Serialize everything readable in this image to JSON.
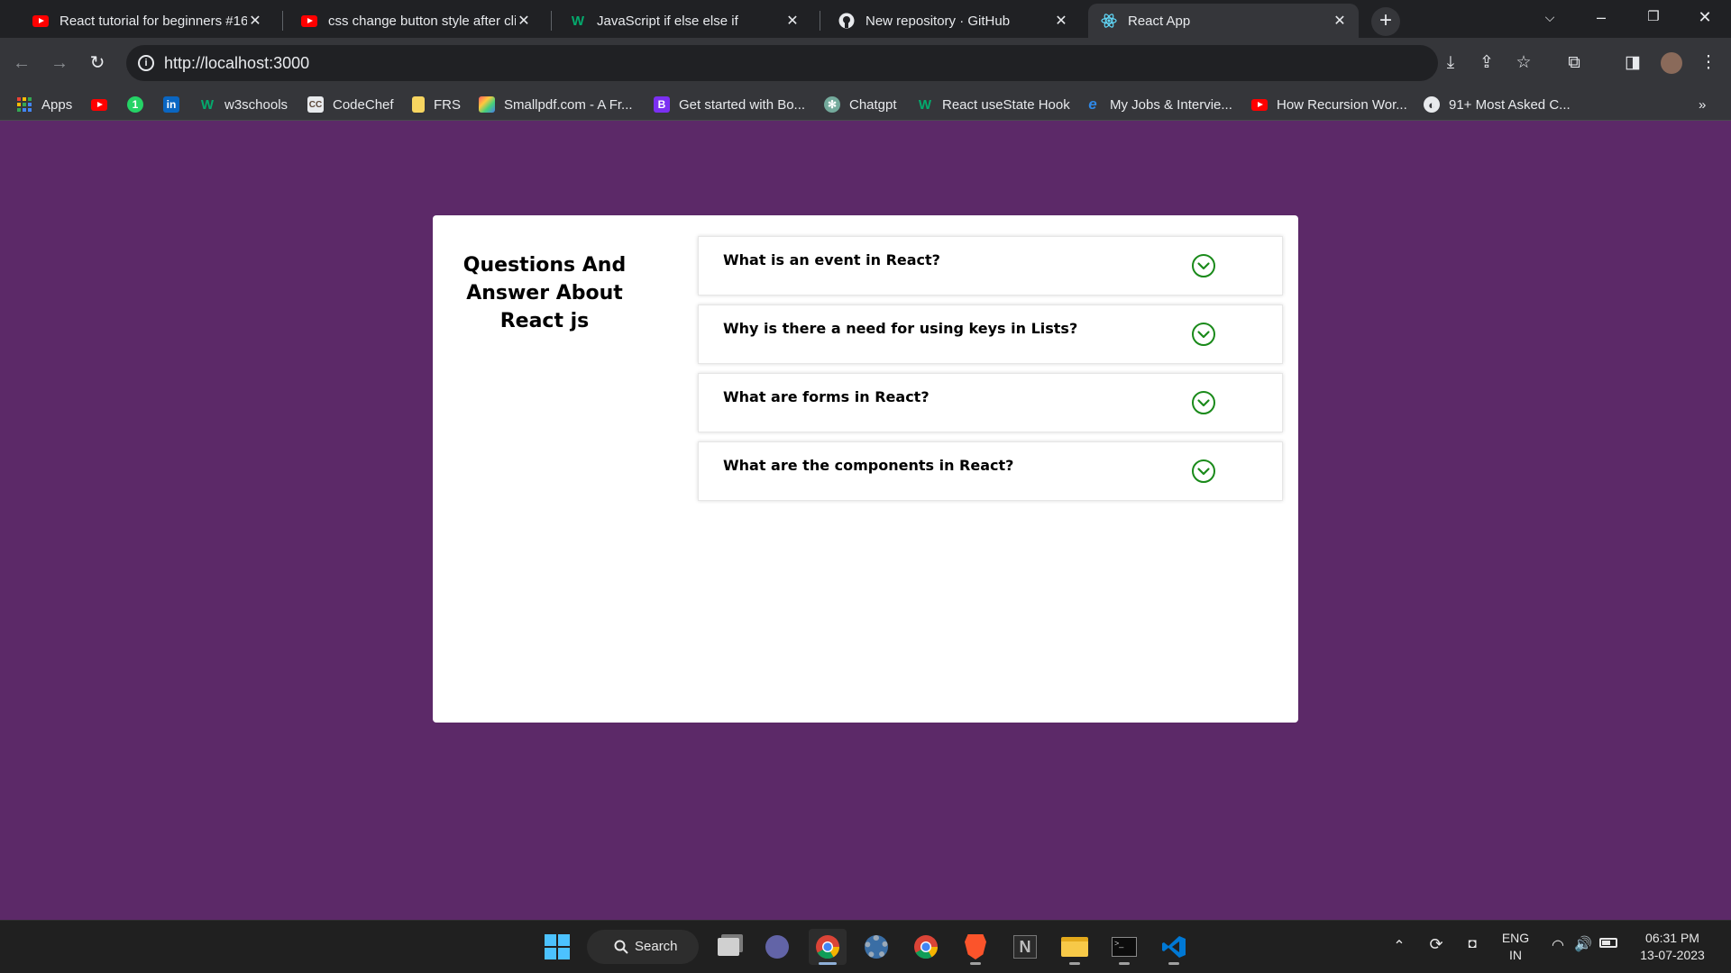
{
  "browser": {
    "tabs": [
      {
        "title": "React tutorial for beginners #16",
        "icon": "youtube-icon"
      },
      {
        "title": "css change button style after click",
        "icon": "youtube-icon"
      },
      {
        "title": "JavaScript if else else if",
        "icon": "w3schools-icon"
      },
      {
        "title": "New repository · GitHub",
        "icon": "github-icon"
      },
      {
        "title": "React App",
        "icon": "react-icon",
        "active": true
      }
    ],
    "url": "http://localhost:3000",
    "bookmarks": [
      {
        "label": "Apps",
        "icon": "apps-grid-icon"
      },
      {
        "label": "",
        "icon": "youtube-icon"
      },
      {
        "label": "",
        "icon": "whatsapp-icon"
      },
      {
        "label": "",
        "icon": "linkedin-icon"
      },
      {
        "label": "w3schools",
        "icon": "w3schools-icon"
      },
      {
        "label": "CodeChef",
        "icon": "codechef-icon"
      },
      {
        "label": "FRS",
        "icon": "folder-icon"
      },
      {
        "label": "Smallpdf.com - A Fr...",
        "icon": "smallpdf-icon"
      },
      {
        "label": "Get started with Bo...",
        "icon": "bootstrap-icon"
      },
      {
        "label": "Chatgpt",
        "icon": "chatgpt-icon"
      },
      {
        "label": "React useState Hook",
        "icon": "w3schools-icon"
      },
      {
        "label": "My Jobs & Intervie...",
        "icon": "edge-icon"
      },
      {
        "label": "How Recursion Wor...",
        "icon": "youtube-icon"
      },
      {
        "label": "91+ Most Asked C...",
        "icon": "globe-icon"
      }
    ],
    "bookmark_overflow": "»"
  },
  "page": {
    "heading": "Questions And Answer About React js",
    "questions": [
      "What is an event in React?",
      "Why is there a need for using keys in Lists?",
      "What are forms in React?",
      "What are the components in React?"
    ],
    "expand_icon": "chevron-circle-down-icon"
  },
  "taskbar": {
    "search_label": "Search",
    "language": "ENG",
    "region": "IN",
    "time": "06:31 PM",
    "date": "13-07-2023"
  },
  "colors": {
    "page_background": "#5c2968",
    "card_background": "#ffffff",
    "expand_icon": "#1a8a1a"
  }
}
